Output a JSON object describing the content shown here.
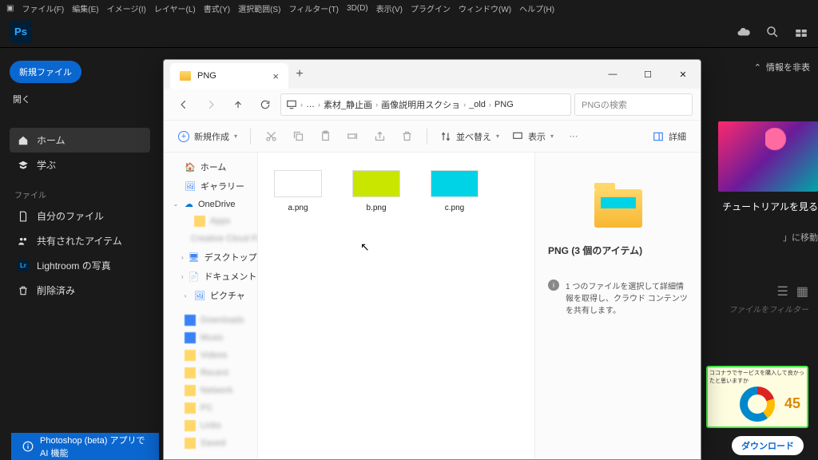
{
  "ps": {
    "menu": [
      "ファイル(F)",
      "編集(E)",
      "イメージ(I)",
      "レイヤー(L)",
      "書式(Y)",
      "選択範囲(S)",
      "フィルター(T)",
      "3D(D)",
      "表示(V)",
      "プラグイン",
      "ウィンドウ(W)",
      "ヘルプ(H)"
    ],
    "logo": "Ps",
    "new_file": "新規ファイル",
    "open": "開く",
    "nav": {
      "home": "ホーム",
      "learn": "学ぶ",
      "file_hdr": "ファイル",
      "my_files": "自分のファイル",
      "shared": "共有されたアイテム",
      "lr": "Lightroom の写真",
      "deleted": "削除済み"
    },
    "info_toggle": "情報を非表",
    "tutorial": "チュートリアルを見る",
    "move": "」に移動",
    "filter_ph": "ファイルをフィルター",
    "bottom": "Photoshop (beta) アプリで AI 機能",
    "download": "ダウンロード",
    "ad": {
      "top": "ココナラでサービスを購入して良かったと思いますか",
      "num": "45"
    }
  },
  "explorer": {
    "tab_title": "PNG",
    "breadcrumb": [
      "…",
      "素材_静止画",
      "画像説明用スクショ",
      "_old",
      "PNG"
    ],
    "search_ph": "PNGの検索",
    "tools": {
      "new": "新規作成",
      "sort": "並べ替え",
      "view": "表示",
      "detail": "詳細"
    },
    "nav": {
      "home": "ホーム",
      "gallery": "ギャラリー",
      "onedrive": "OneDrive",
      "desktop": "デスクトップ",
      "documents": "ドキュメント",
      "pictures": "ピクチャ",
      "blurred": [
        "Apps",
        "Creative Cloud Fil",
        "Downloads",
        "Music",
        "Videos",
        "Recent",
        "Network",
        "PC",
        "Links",
        "Saved"
      ]
    },
    "files": [
      {
        "name": "a.png",
        "swatch": "white"
      },
      {
        "name": "b.png",
        "swatch": "lime"
      },
      {
        "name": "c.png",
        "swatch": "cyan"
      }
    ],
    "detail": {
      "title": "PNG (3 個のアイテム)",
      "hint": "1 つのファイルを選択して詳細情報を取得し、クラウド コンテンツを共有します。"
    }
  }
}
